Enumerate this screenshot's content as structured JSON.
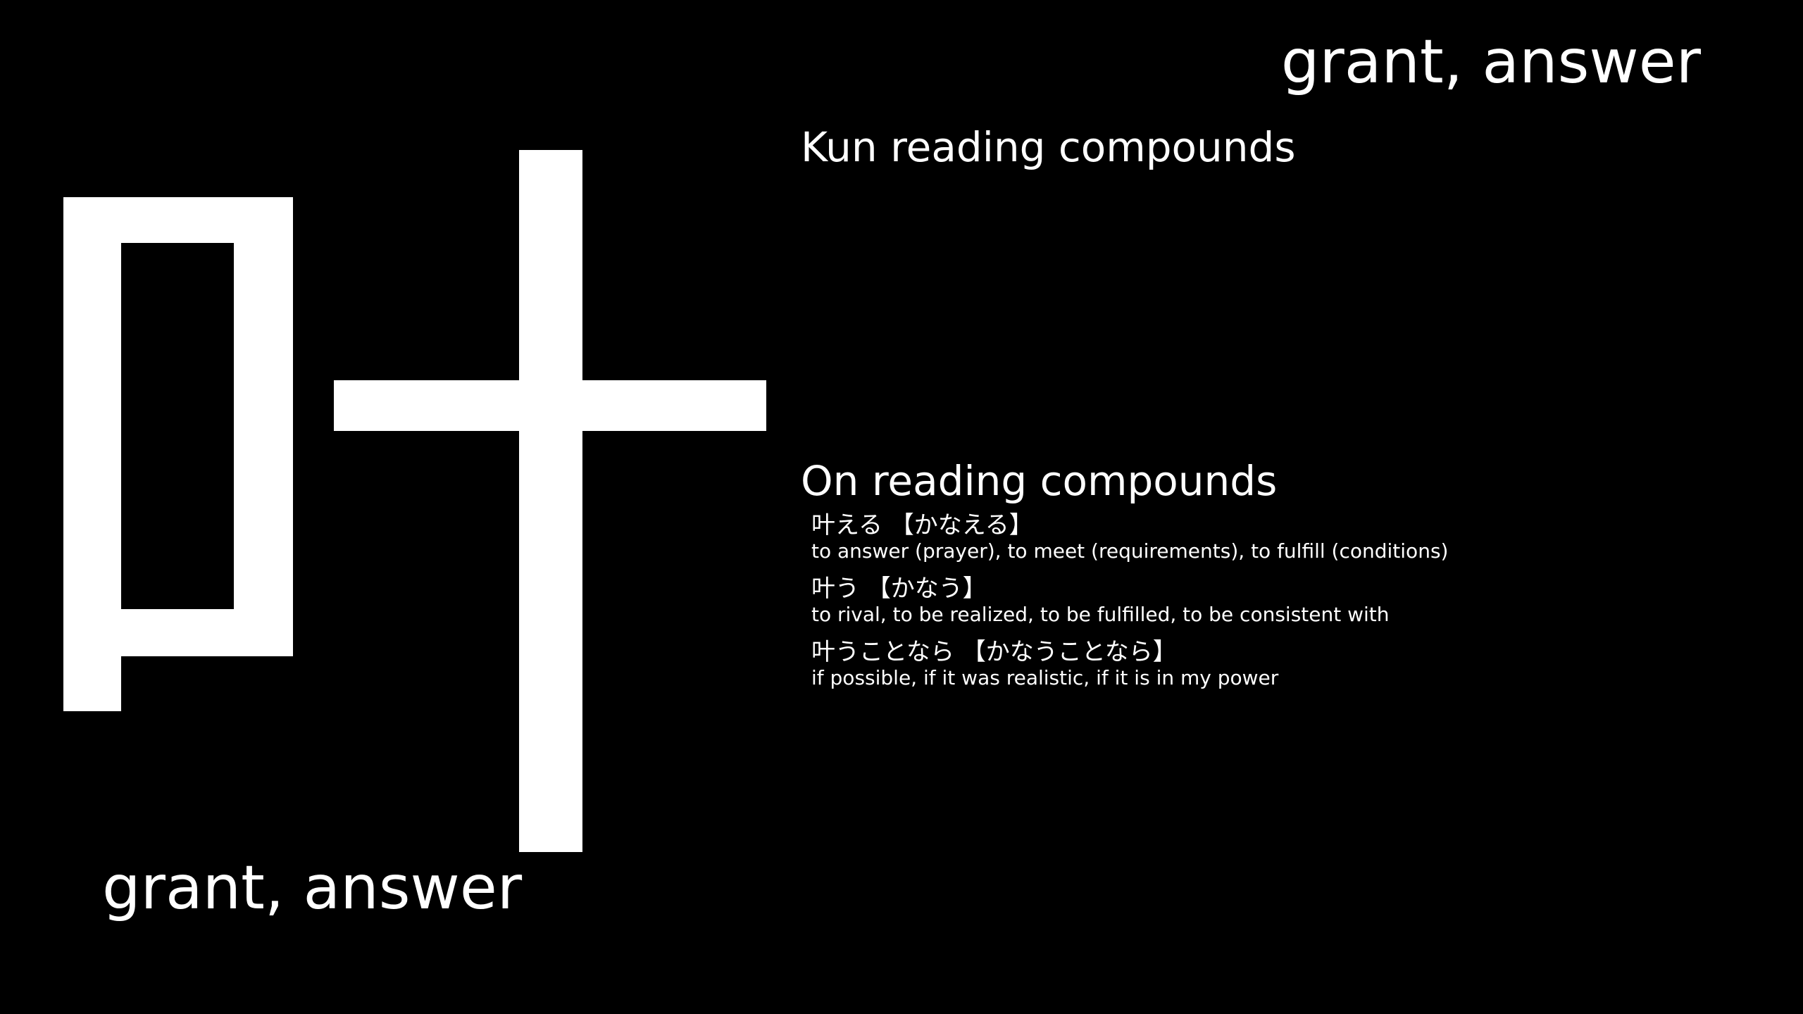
{
  "kanji": {
    "character": "叶",
    "color": "#ffffff"
  },
  "meaning_top": "grant, answer",
  "meaning_bottom": "grant, answer",
  "kun_heading": "Kun reading compounds",
  "on_heading": "On reading compounds",
  "on_compounds": [
    {
      "term": "叶える 【かなえる】",
      "definition": "to answer (prayer), to meet (requirements), to fulfill (conditions)"
    },
    {
      "term": "叶う 【かなう】",
      "definition": "to rival, to be realized, to be fulfilled, to be consistent with"
    },
    {
      "term": "叶うことなら 【かなうことなら】",
      "definition": "if possible, if it was realistic, if it is in my power"
    }
  ],
  "background_color": "#000000"
}
